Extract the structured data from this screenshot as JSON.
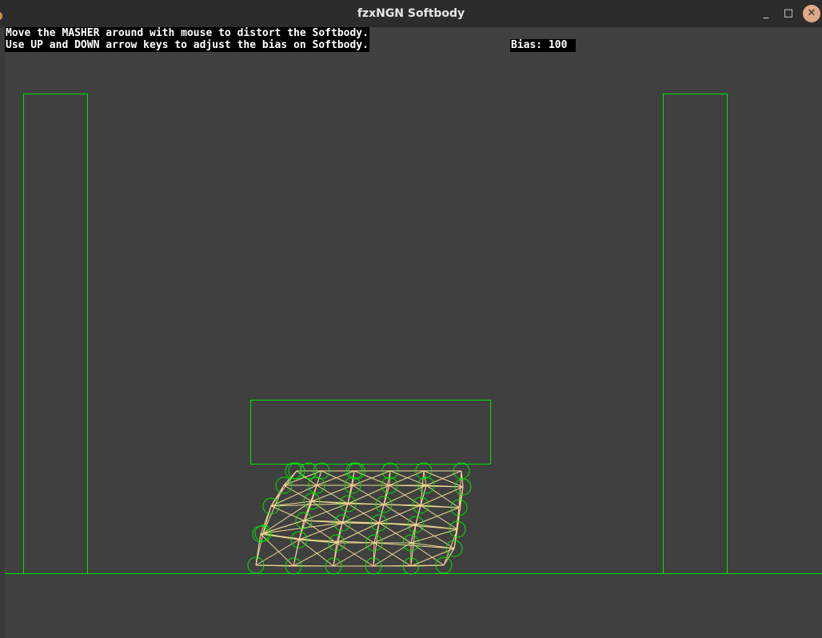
{
  "window": {
    "title": "fzxNGN Softbody",
    "minimize_label": "_",
    "maximize_label": "□",
    "close_label": "✕"
  },
  "hud": {
    "line1": "Move the MASHER around with mouse to distort the Softbody.",
    "line2": "Use UP and DOWN arrow keys to adjust the bias on Softbody.",
    "bias_label": "Bias:",
    "bias_value": 100
  },
  "colors": {
    "background": "#404040",
    "outline": "#00e600",
    "spring": "#f0d890",
    "hud_bg": "#000000",
    "hud_text": "#ffffff"
  },
  "icons": [
    "minimize-icon",
    "maximize-icon",
    "close-icon"
  ]
}
